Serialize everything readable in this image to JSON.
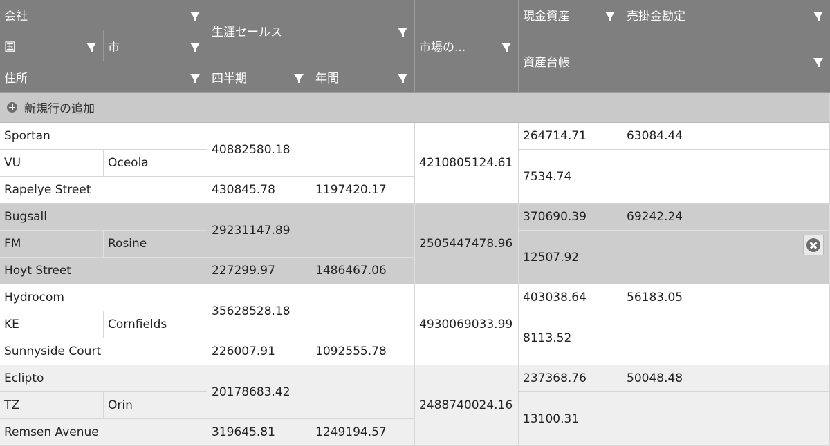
{
  "headers": {
    "company": "会社",
    "lifetime_sales": "生涯セールス",
    "market": "市場の...",
    "cash_assets": "現金資産",
    "accounts_receivable": "売掛金勘定",
    "country": "国",
    "city": "市",
    "asset_ledger": "資産台帳",
    "address": "住所",
    "quarterly": "四半期",
    "annual": "年間"
  },
  "add_row": {
    "label": "新規行の追加"
  },
  "records": [
    {
      "company": "Sportan",
      "country": "VU",
      "city": "Oceola",
      "address": "Rapelye Street",
      "lifetime_sales": "40882580.18",
      "quarterly": "430845.78",
      "annual": "1197420.17",
      "market": "4210805124.61",
      "cash_assets": "264714.71",
      "accounts_receivable": "63084.44",
      "asset_ledger": "7534.74"
    },
    {
      "company": "Bugsall",
      "country": "FM",
      "city": "Rosine",
      "address": "Hoyt Street",
      "lifetime_sales": "29231147.89",
      "quarterly": "227299.97",
      "annual": "1486467.06",
      "market": "2505447478.96",
      "cash_assets": "370690.39",
      "accounts_receivable": "69242.24",
      "asset_ledger": "12507.92"
    },
    {
      "company": "Hydrocom",
      "country": "KE",
      "city": "Cornfields",
      "address": "Sunnyside Court",
      "lifetime_sales": "35628528.18",
      "quarterly": "226007.91",
      "annual": "1092555.78",
      "market": "4930069033.99",
      "cash_assets": "403038.64",
      "accounts_receivable": "56183.05",
      "asset_ledger": "8113.52"
    },
    {
      "company": "Eclipto",
      "country": "TZ",
      "city": "Orin",
      "address": "Remsen Avenue",
      "lifetime_sales": "20178683.42",
      "quarterly": "319645.81",
      "annual": "1249194.57",
      "market": "2488740024.16",
      "cash_assets": "237368.76",
      "accounts_receivable": "50048.48",
      "asset_ledger": "13100.31"
    }
  ]
}
